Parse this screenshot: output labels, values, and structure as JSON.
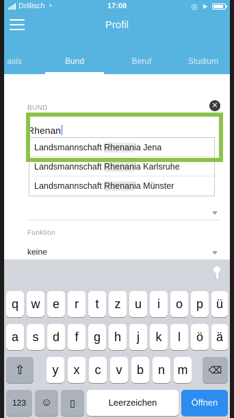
{
  "status": {
    "carrier": "Drillisch",
    "time": "17:08"
  },
  "nav": {
    "title": "Profil"
  },
  "tabs": [
    {
      "label": "asis"
    },
    {
      "label": "Bund"
    },
    {
      "label": "Beruf"
    },
    {
      "label": "Studium"
    }
  ],
  "form": {
    "bund_label": "BUND",
    "bund_value": "Rhenan",
    "suggestions": [
      {
        "before": "Landsmannschaft ",
        "match": "Rhenan",
        "after": "ia Jena"
      },
      {
        "before": "Landsmannschaft ",
        "match": "Rhenan",
        "after": "ia Karlsruhe"
      },
      {
        "before": "Landsmannschaft ",
        "match": "Rhenan",
        "after": "ia Münster"
      }
    ],
    "funktion_label": "Funktion",
    "funktion_value": "keine"
  },
  "keyboard": {
    "row1": [
      "q",
      "w",
      "e",
      "r",
      "t",
      "z",
      "u",
      "i",
      "o",
      "p",
      "ü"
    ],
    "row2": [
      "a",
      "s",
      "d",
      "f",
      "g",
      "h",
      "j",
      "k",
      "l",
      "ö",
      "ä"
    ],
    "row3": [
      "y",
      "x",
      "c",
      "v",
      "b",
      "n",
      "m"
    ],
    "numbers_label": "123",
    "space_label": "Leerzeichen",
    "return_label": "Öffnen"
  },
  "colors": {
    "header": "#57b4e0",
    "accent": "#8bc34a",
    "return_key": "#2d8cf0"
  }
}
